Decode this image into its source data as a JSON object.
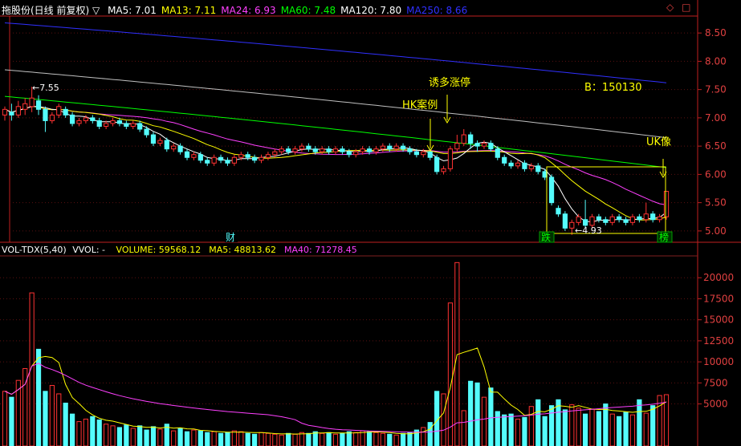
{
  "header": {
    "title": "拖股份(日线 前复权) ▽",
    "ma_items": [
      {
        "label": "MA5: 7.01",
        "color": "#ffffff"
      },
      {
        "label": "MA13: 7.11",
        "color": "#ffff00"
      },
      {
        "label": "MA24: 6.93",
        "color": "#ff40ff"
      },
      {
        "label": "MA60: 7.48",
        "color": "#00ff00"
      },
      {
        "label": "MA120: 7.80",
        "color": "#ffffff"
      },
      {
        "label": "MA250: 8.66",
        "color": "#3030ff"
      }
    ],
    "icon_label": "◇",
    "box_label": "□"
  },
  "volume_header": {
    "title": "VOL-TDX(5,40)",
    "vvol": "VVOL: -",
    "items": [
      {
        "label": "VOLUME: 59568.12",
        "color": "#ffff00"
      },
      {
        "label": "MA5: 48813.62",
        "color": "#ffff00"
      },
      {
        "label": "MA40: 71278.45",
        "color": "#ff40ff"
      }
    ]
  },
  "price_axis": {
    "min": 4.8,
    "max": 8.8,
    "ticks": [
      "8.50",
      "8.00",
      "7.50",
      "7.00",
      "6.50",
      "6.00",
      "5.50",
      "5.00"
    ]
  },
  "volume_axis": {
    "min": 0,
    "max": 22500,
    "ticks": [
      "20000",
      "17500",
      "15000",
      "12500",
      "10000",
      "7500",
      "5000"
    ]
  },
  "annotations": {
    "hk": "HK案例",
    "yd": "诱多涨停",
    "b": "B：150130",
    "uk": "UK像",
    "high": "7.55",
    "low": "4.93",
    "cai": "财",
    "die": "跌",
    "bang": "榜"
  },
  "colors": {
    "up": "#ff3232",
    "down": "#54fcfc",
    "ma5": "#ffffff",
    "ma13": "#ffff00",
    "ma24": "#ff40ff",
    "ma60": "#00ff00",
    "ma120": "#c0c0c0",
    "ma250": "#3030ff",
    "axis": "#c02020",
    "ann_yellow": "#ffff00"
  },
  "chart_data": {
    "type": "candlestick",
    "candles": [
      [
        7.05,
        7.15,
        7.2,
        6.95
      ],
      [
        7.1,
        7.05,
        7.25,
        6.95
      ],
      [
        7.05,
        7.2,
        7.3,
        7.0
      ],
      [
        7.15,
        7.25,
        7.35,
        7.05
      ],
      [
        7.2,
        7.35,
        7.55,
        7.1
      ],
      [
        7.3,
        7.15,
        7.4,
        7.05
      ],
      [
        7.15,
        6.95,
        7.2,
        6.75
      ],
      [
        6.95,
        7.05,
        7.1,
        6.9
      ],
      [
        7.05,
        7.2,
        7.25,
        7.0
      ],
      [
        7.15,
        7.05,
        7.2,
        7.0
      ],
      [
        7.05,
        6.9,
        7.1,
        6.85
      ],
      [
        6.9,
        6.95,
        7.0,
        6.85
      ],
      [
        6.95,
        7.0,
        7.05,
        6.9
      ],
      [
        7.0,
        6.95,
        7.05,
        6.9
      ],
      [
        6.95,
        6.85,
        7.0,
        6.8
      ],
      [
        6.85,
        6.9,
        6.95,
        6.8
      ],
      [
        6.9,
        6.95,
        7.0,
        6.85
      ],
      [
        6.95,
        6.9,
        7.0,
        6.85
      ],
      [
        6.9,
        6.85,
        6.95,
        6.8
      ],
      [
        6.85,
        6.9,
        6.95,
        6.8
      ],
      [
        6.9,
        6.8,
        6.95,
        6.75
      ],
      [
        6.8,
        6.7,
        6.85,
        6.65
      ],
      [
        6.7,
        6.55,
        6.75,
        6.5
      ],
      [
        6.55,
        6.6,
        6.65,
        6.5
      ],
      [
        6.6,
        6.45,
        6.65,
        6.4
      ],
      [
        6.45,
        6.5,
        6.55,
        6.4
      ],
      [
        6.5,
        6.4,
        6.55,
        6.35
      ],
      [
        6.4,
        6.3,
        6.45,
        6.25
      ],
      [
        6.3,
        6.35,
        6.4,
        6.25
      ],
      [
        6.35,
        6.25,
        6.4,
        6.2
      ],
      [
        6.25,
        6.2,
        6.3,
        6.15
      ],
      [
        6.2,
        6.3,
        6.35,
        6.15
      ],
      [
        6.3,
        6.25,
        6.35,
        6.2
      ],
      [
        6.25,
        6.2,
        6.3,
        6.15
      ],
      [
        6.2,
        6.3,
        6.35,
        6.15
      ],
      [
        6.3,
        6.35,
        6.4,
        6.25
      ],
      [
        6.35,
        6.3,
        6.4,
        6.25
      ],
      [
        6.3,
        6.25,
        6.35,
        6.2
      ],
      [
        6.25,
        6.3,
        6.35,
        6.2
      ],
      [
        6.3,
        6.35,
        6.4,
        6.25
      ],
      [
        6.35,
        6.4,
        6.45,
        6.3
      ],
      [
        6.4,
        6.45,
        6.5,
        6.35
      ],
      [
        6.45,
        6.4,
        6.5,
        6.35
      ],
      [
        6.4,
        6.45,
        6.5,
        6.35
      ],
      [
        6.45,
        6.5,
        6.55,
        6.4
      ],
      [
        6.5,
        6.45,
        6.55,
        6.4
      ],
      [
        6.45,
        6.4,
        6.5,
        6.35
      ],
      [
        6.4,
        6.45,
        6.5,
        6.35
      ],
      [
        6.45,
        6.4,
        6.5,
        6.35
      ],
      [
        6.4,
        6.45,
        6.5,
        6.35
      ],
      [
        6.45,
        6.4,
        6.5,
        6.35
      ],
      [
        6.4,
        6.35,
        6.45,
        6.3
      ],
      [
        6.35,
        6.4,
        6.45,
        6.3
      ],
      [
        6.4,
        6.45,
        6.5,
        6.35
      ],
      [
        6.45,
        6.4,
        6.5,
        6.35
      ],
      [
        6.4,
        6.45,
        6.5,
        6.35
      ],
      [
        6.45,
        6.5,
        6.55,
        6.4
      ],
      [
        6.5,
        6.45,
        6.55,
        6.4
      ],
      [
        6.45,
        6.5,
        6.55,
        6.4
      ],
      [
        6.5,
        6.45,
        6.55,
        6.4
      ],
      [
        6.45,
        6.4,
        6.5,
        6.35
      ],
      [
        6.4,
        6.35,
        6.45,
        6.3
      ],
      [
        6.35,
        6.4,
        6.45,
        6.3
      ],
      [
        6.4,
        6.3,
        6.45,
        6.25
      ],
      [
        6.3,
        6.05,
        6.35,
        6.0
      ],
      [
        6.05,
        6.1,
        6.15,
        6.0
      ],
      [
        6.1,
        6.45,
        6.5,
        6.05
      ],
      [
        6.45,
        6.55,
        6.7,
        6.4
      ],
      [
        6.55,
        6.7,
        6.8,
        6.5
      ],
      [
        6.7,
        6.55,
        6.75,
        6.45
      ],
      [
        6.55,
        6.5,
        6.6,
        6.4
      ],
      [
        6.5,
        6.55,
        6.6,
        6.45
      ],
      [
        6.55,
        6.45,
        6.6,
        6.4
      ],
      [
        6.45,
        6.3,
        6.5,
        6.25
      ],
      [
        6.3,
        6.2,
        6.35,
        6.15
      ],
      [
        6.2,
        6.15,
        6.25,
        6.1
      ],
      [
        6.15,
        6.2,
        6.25,
        6.1
      ],
      [
        6.2,
        6.1,
        6.25,
        6.05
      ],
      [
        6.1,
        6.15,
        6.2,
        6.05
      ],
      [
        6.15,
        6.05,
        6.2,
        6.0
      ],
      [
        6.05,
        5.95,
        6.1,
        5.9
      ],
      [
        5.95,
        5.5,
        6.0,
        5.45
      ],
      [
        5.4,
        5.3,
        5.45,
        5.25
      ],
      [
        5.3,
        5.05,
        5.35,
        5.0
      ],
      [
        5.05,
        5.15,
        5.2,
        4.93
      ],
      [
        5.15,
        5.25,
        5.3,
        5.1
      ],
      [
        5.2,
        5.1,
        5.55,
        5.05
      ],
      [
        5.1,
        5.25,
        5.3,
        5.05
      ],
      [
        5.25,
        5.2,
        5.3,
        5.15
      ],
      [
        5.2,
        5.15,
        5.25,
        5.1
      ],
      [
        5.15,
        5.25,
        5.3,
        5.1
      ],
      [
        5.25,
        5.2,
        5.3,
        5.15
      ],
      [
        5.2,
        5.15,
        5.25,
        5.1
      ],
      [
        5.15,
        5.25,
        5.3,
        5.1
      ],
      [
        5.25,
        5.2,
        5.3,
        5.15
      ],
      [
        5.2,
        5.3,
        5.5,
        5.15
      ],
      [
        5.3,
        5.2,
        5.35,
        5.15
      ],
      [
        5.2,
        5.25,
        5.3,
        5.15
      ],
      [
        5.25,
        5.7,
        5.7,
        5.2
      ]
    ],
    "volumes": [
      6500,
      5800,
      7800,
      9200,
      18200,
      11500,
      6500,
      7200,
      6200,
      5100,
      3800,
      2900,
      3200,
      3500,
      3100,
      2600,
      2400,
      2200,
      2500,
      2100,
      2400,
      1900,
      2300,
      2000,
      2600,
      1800,
      2100,
      1700,
      1900,
      1800,
      1600,
      1700,
      1500,
      1600,
      1800,
      1700,
      1500,
      1400,
      1600,
      1500,
      1400,
      1300,
      1500,
      1400,
      1600,
      1500,
      1700,
      1500,
      1600,
      1400,
      1500,
      1700,
      1600,
      1800,
      1700,
      1600,
      1500,
      1400,
      1300,
      1500,
      1600,
      1900,
      2200,
      2800,
      6500,
      6200,
      17000,
      21800,
      4200,
      7700,
      7500,
      5800,
      6900,
      4100,
      3700,
      3800,
      3200,
      3400,
      4700,
      5500,
      3500,
      4800,
      5500,
      4300,
      4900,
      4500,
      3800,
      4400,
      4100,
      5000,
      3800,
      3500,
      4000,
      3700,
      5500,
      3900,
      4800,
      6000,
      6100
    ],
    "ma_lines": {
      "ma250": {
        "start": 8.68,
        "end": 7.62
      },
      "ma120": {
        "start": 7.85,
        "end": 6.65
      },
      "ma60": {
        "start": 7.38,
        "end": 6.12
      }
    }
  }
}
